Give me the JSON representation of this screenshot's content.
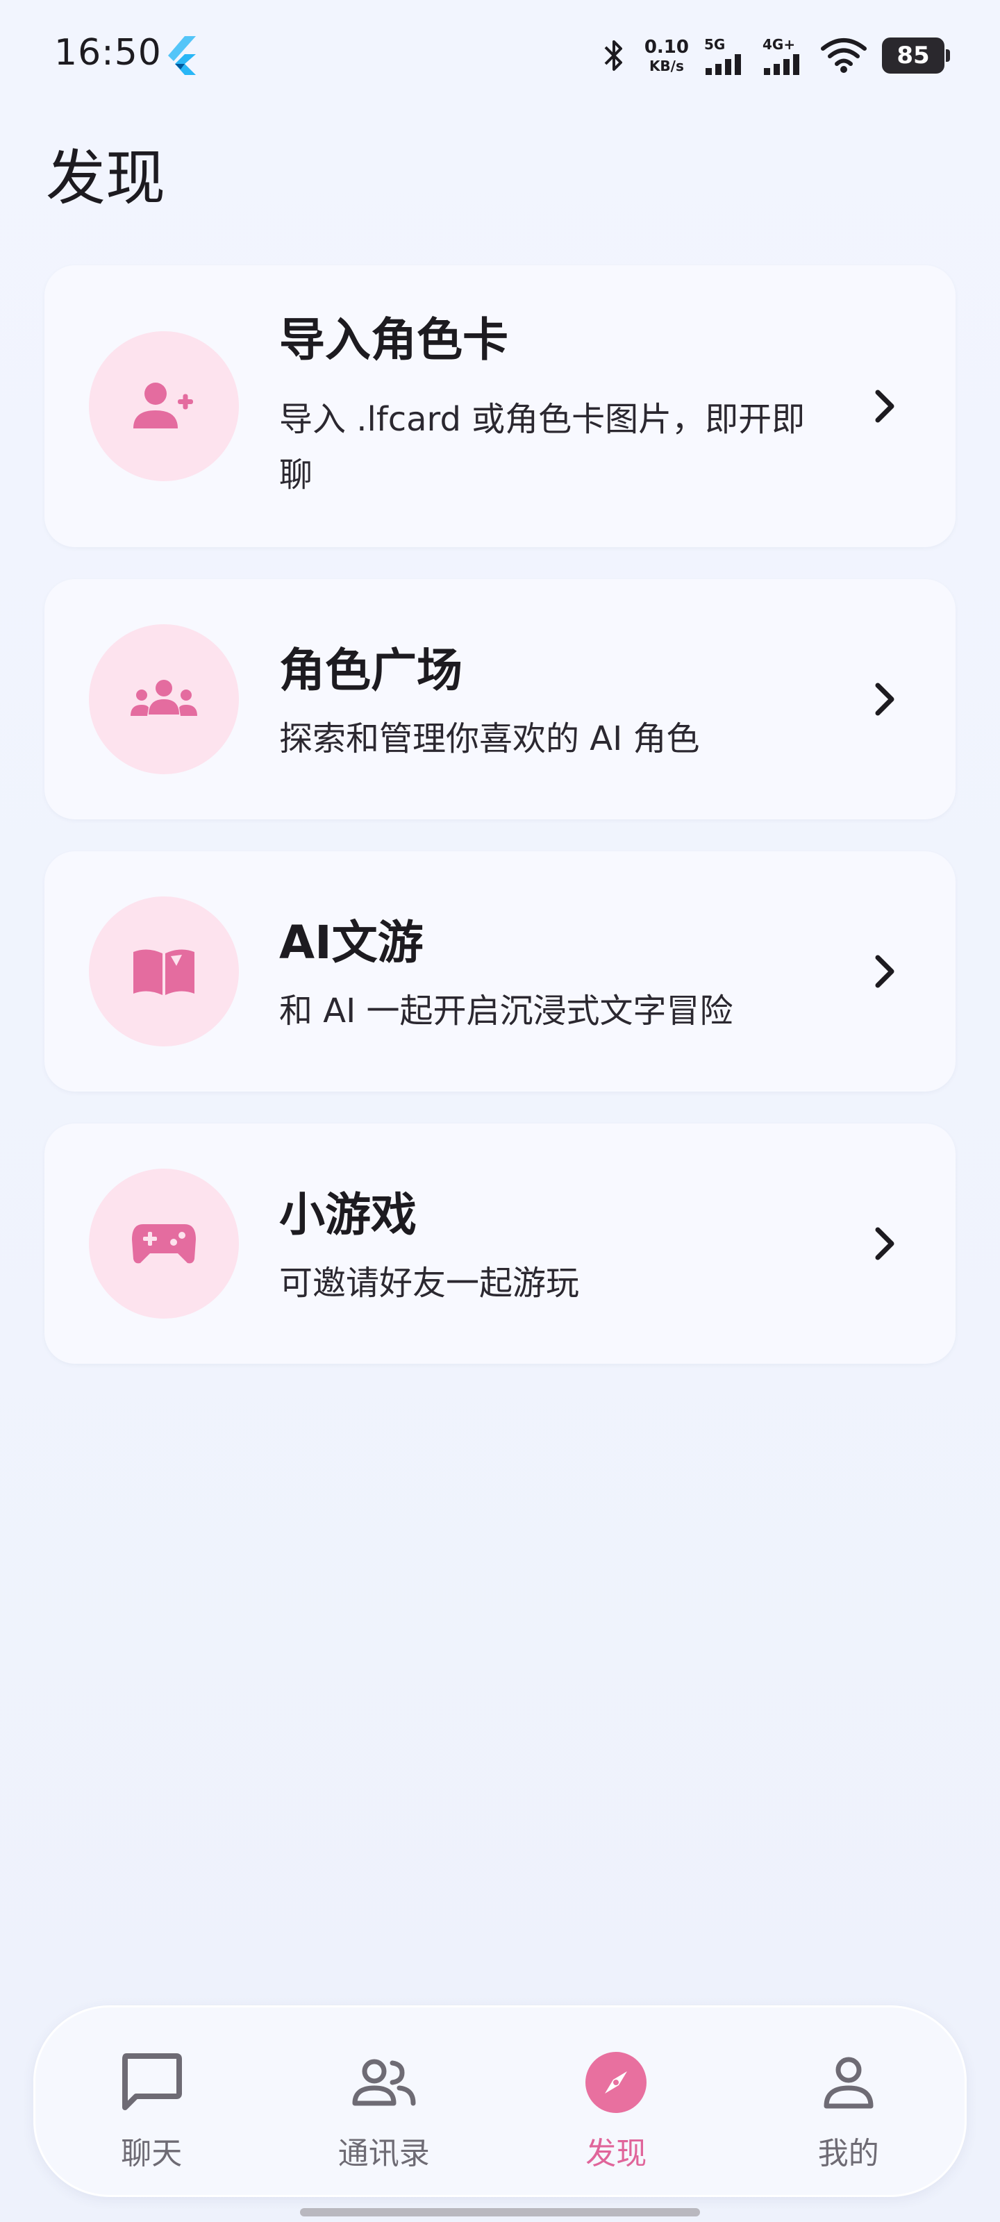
{
  "status_bar": {
    "time": "16:50",
    "net_speed_value": "0.10",
    "net_speed_unit": "KB/s",
    "signal1_label": "5G",
    "signal2_label": "4G+",
    "battery": "85"
  },
  "page": {
    "title": "发现"
  },
  "cards": [
    {
      "title": "导入角色卡",
      "description": "导入 .lfcard 或角色卡图片，即开即聊",
      "icon": "person-add-icon"
    },
    {
      "title": "角色广场",
      "description": "探索和管理你喜欢的 AI 角色",
      "icon": "groups-icon"
    },
    {
      "title": "AI文游",
      "description": "和 AI 一起开启沉浸式文字冒险",
      "icon": "book-icon"
    },
    {
      "title": "小游戏",
      "description": "可邀请好友一起游玩",
      "icon": "gamepad-icon"
    }
  ],
  "bottom_nav": {
    "items": [
      {
        "label": "聊天",
        "icon": "chat-bubble-icon"
      },
      {
        "label": "通讯录",
        "icon": "contacts-icon"
      },
      {
        "label": "发现",
        "icon": "compass-icon",
        "active": true
      },
      {
        "label": "我的",
        "icon": "person-icon"
      }
    ]
  },
  "colors": {
    "accent": "#e0659a",
    "icon_bg": "#fde3ee",
    "background": "#f1f4fd",
    "card": "#f8f9ff"
  }
}
